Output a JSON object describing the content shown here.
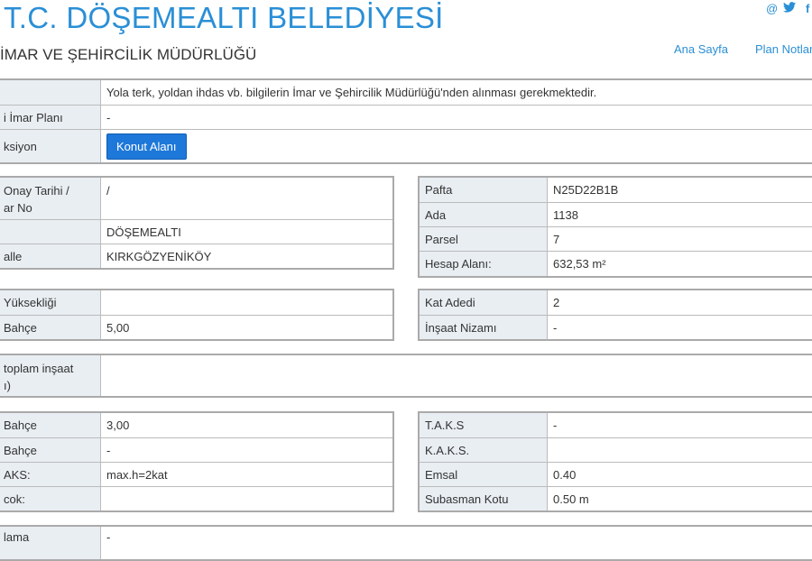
{
  "header": {
    "title": "T.C. DÖŞEMEALTI BELEDİYESİ",
    "subtitle": "İMAR VE ŞEHİRCİLİK MÜDÜRLÜĞÜ",
    "nav": {
      "home": "Ana Sayfa",
      "plan_notes": "Plan Notları"
    },
    "social": {
      "email_icon": "@",
      "twitter_icon": "🐦",
      "facebook_icon": "f"
    }
  },
  "info_table": {
    "rows": [
      {
        "label": "",
        "value": "Yola terk, yoldan ihdas vb. bilgilerin İmar ve Şehircilik Müdürlüğü'nden alınması gerekmektedir."
      },
      {
        "label": "i İmar Planı",
        "value": "-"
      },
      {
        "label": "ksiyon",
        "button": "Konut Alanı"
      }
    ]
  },
  "left1": {
    "rows": [
      {
        "label": "Onay Tarihi /",
        "label2": "ar No",
        "value": "/"
      },
      {
        "label": "",
        "value": "DÖŞEMEALTI"
      },
      {
        "label": "alle",
        "value": "KIRKGÖZYENİKÖY"
      }
    ]
  },
  "right1": {
    "rows": [
      {
        "label": "Pafta",
        "value": "N25D22B1B"
      },
      {
        "label": "Ada",
        "value": "1138"
      },
      {
        "label": "Parsel",
        "value": "7"
      },
      {
        "label": "Hesap Alanı:",
        "value": "632,53 m²"
      }
    ]
  },
  "left2": {
    "rows": [
      {
        "label": "Yüksekliği",
        "value": ""
      },
      {
        "label": "Bahçe",
        "value": "5,00"
      }
    ]
  },
  "right2": {
    "rows": [
      {
        "label": "Kat Adedi",
        "value": "2"
      },
      {
        "label": "İnşaat Nizamı",
        "value": "-"
      }
    ]
  },
  "wide": {
    "label": "toplam inşaat",
    "label2": "ı)",
    "value": ""
  },
  "left3": {
    "rows": [
      {
        "label": "Bahçe",
        "value": "3,00"
      },
      {
        "label": "Bahçe",
        "value": "-"
      },
      {
        "label": "AKS:",
        "value": "max.h=2kat"
      },
      {
        "label": "cok:",
        "value": ""
      }
    ]
  },
  "right3": {
    "rows": [
      {
        "label": "T.A.K.S",
        "value": "-"
      },
      {
        "label": "K.A.K.S.",
        "value": ""
      },
      {
        "label": "Emsal",
        "value": "0.40"
      },
      {
        "label": "Subasman Kotu",
        "value": "0.50 m"
      }
    ]
  },
  "bottom": {
    "label": "lama",
    "value": "-"
  }
}
